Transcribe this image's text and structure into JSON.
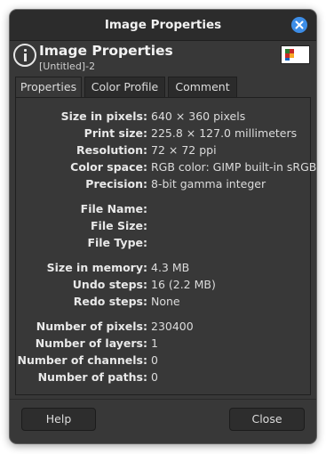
{
  "window": {
    "title": "Image Properties"
  },
  "header": {
    "title": "Image Properties",
    "subtitle": "[Untitled]-2"
  },
  "tabs": [
    {
      "label": "Properties",
      "active": true
    },
    {
      "label": "Color Profile",
      "active": false
    },
    {
      "label": "Comment",
      "active": false
    }
  ],
  "properties": [
    {
      "label": "Size in pixels:",
      "value": "640 × 360 pixels"
    },
    {
      "label": "Print size:",
      "value": "225.8 × 127.0 millimeters"
    },
    {
      "label": "Resolution:",
      "value": "72 × 72 ppi"
    },
    {
      "label": "Color space:",
      "value": "RGB color: GIMP built-in sRGB"
    },
    {
      "label": "Precision:",
      "value": "8-bit gamma integer"
    },
    {
      "label": "File Name:",
      "value": ""
    },
    {
      "label": "File Size:",
      "value": ""
    },
    {
      "label": "File Type:",
      "value": ""
    },
    {
      "label": "Size in memory:",
      "value": "4.3 MB"
    },
    {
      "label": "Undo steps:",
      "value": "16 (2.2 MB)"
    },
    {
      "label": "Redo steps:",
      "value": "None"
    },
    {
      "label": "Number of pixels:",
      "value": "230400"
    },
    {
      "label": "Number of layers:",
      "value": "1"
    },
    {
      "label": "Number of channels:",
      "value": "0"
    },
    {
      "label": "Number of paths:",
      "value": "0"
    }
  ],
  "buttons": {
    "help": "Help",
    "close": "Close"
  },
  "colors": {
    "accent": "#3d8ee8",
    "window_bg": "#383838",
    "titlebar_bg": "#2c2c2c"
  },
  "icons": {
    "close": "close-icon",
    "info": "info-icon",
    "thumbnail": "image-thumbnail"
  }
}
